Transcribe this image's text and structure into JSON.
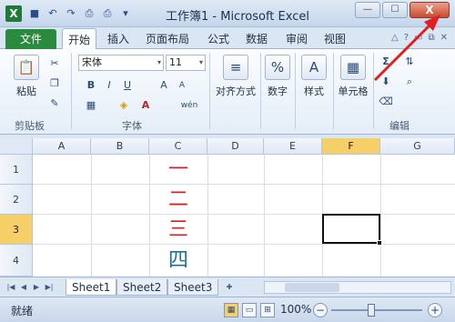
{
  "window": {
    "title": "工作簿1 - Microsoft Excel",
    "app_icon": "X",
    "qat_icons": [
      "save-icon",
      "undo-icon",
      "redo-icon",
      "print-preview-icon",
      "quick-print-icon",
      "customize-qat-icon"
    ],
    "controls": {
      "minimize": "—",
      "maximize": "☐",
      "close": "X"
    }
  },
  "ribbon": {
    "file_tab": "文件",
    "tabs": [
      "开始",
      "插入",
      "页面布局",
      "公式",
      "数据",
      "审阅",
      "视图"
    ],
    "active_tab": "开始",
    "right_icons": [
      "△",
      "?",
      "▭",
      "⧉",
      "✕"
    ],
    "clipboard": {
      "paste": "粘贴",
      "label": "剪贴板"
    },
    "font": {
      "name": "宋体",
      "size": "11",
      "bold": "B",
      "italic": "I",
      "underline": "U",
      "grow": "A",
      "shrink": "A",
      "wen": "wén",
      "label": "字体"
    },
    "alignment": {
      "label": "对齐方式"
    },
    "number": {
      "label": "数字",
      "icon_text": "%"
    },
    "styles": {
      "label": "样式",
      "icon_text": "A"
    },
    "cells": {
      "label": "单元格"
    },
    "editing": {
      "label": "编辑",
      "sum": "Σ"
    }
  },
  "grid": {
    "columns": [
      "A",
      "B",
      "C",
      "D",
      "E",
      "F",
      "G"
    ],
    "selected_column": "F",
    "rows": [
      "1",
      "2",
      "3",
      "4"
    ],
    "selected_row": "3",
    "cells": [
      {
        "ref": "C1",
        "text": "一",
        "color": "#d42020"
      },
      {
        "ref": "C2",
        "text": "二",
        "color": "#d42020"
      },
      {
        "ref": "C3",
        "text": "三",
        "color": "#d42020"
      },
      {
        "ref": "C4",
        "text": "四",
        "color": "#1f6f9e"
      }
    ],
    "active_cell": "F3"
  },
  "sheets": {
    "tabs": [
      "Sheet1",
      "Sheet2",
      "Sheet3"
    ],
    "active": "Sheet1"
  },
  "status": {
    "text": "就绪",
    "zoom": "100%",
    "zoom_out": "−",
    "zoom_in": "+"
  }
}
